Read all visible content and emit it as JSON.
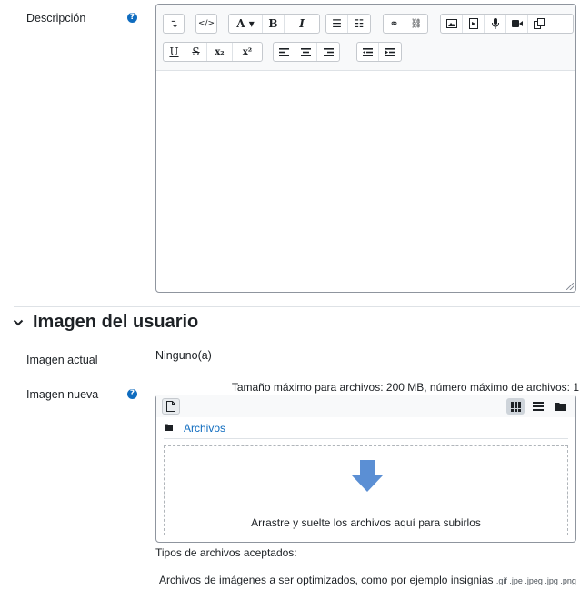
{
  "description": {
    "label": "Descripción",
    "help_icon": "question-circle-icon",
    "toolbar": {
      "row1": [
        [
          "collapse-icon",
          "code-icon",
          "font-style-icon",
          "bold-icon",
          "italic-icon",
          "unordered-list-icon",
          "ordered-list-icon",
          "link-icon",
          "unlink-icon",
          "image-icon",
          "media-icon",
          "record-audio-icon",
          "record-video-icon",
          "manage-files-icon"
        ]
      ],
      "labels": {
        "bold": "B",
        "italic": "I",
        "font_style": "A ▾",
        "underline": "U",
        "strike": "S",
        "subscript": "x₂",
        "superscript": "x²"
      }
    }
  },
  "user_image": {
    "section_title": "Imagen del usuario",
    "current_label": "Imagen actual",
    "current_value": "Ninguno(a)",
    "new_label": "Imagen nueva",
    "limits": "Tamaño máximo para archivos: 200 MB, número máximo de archivos: 1",
    "folder_label": "Archivos",
    "drop_text": "Arrastre y suelte los archivos aquí para subirlos",
    "accepted_title": "Tipos de archivos aceptados:",
    "accepted_desc": "Archivos de imágenes a ser optimizados, como por ejemplo insignias",
    "accepted_ext": ".gif .jpe .jpeg .jpg .png"
  },
  "colors": {
    "accent": "#0f6cbf",
    "drop_arrow": "#5b8fd4"
  }
}
